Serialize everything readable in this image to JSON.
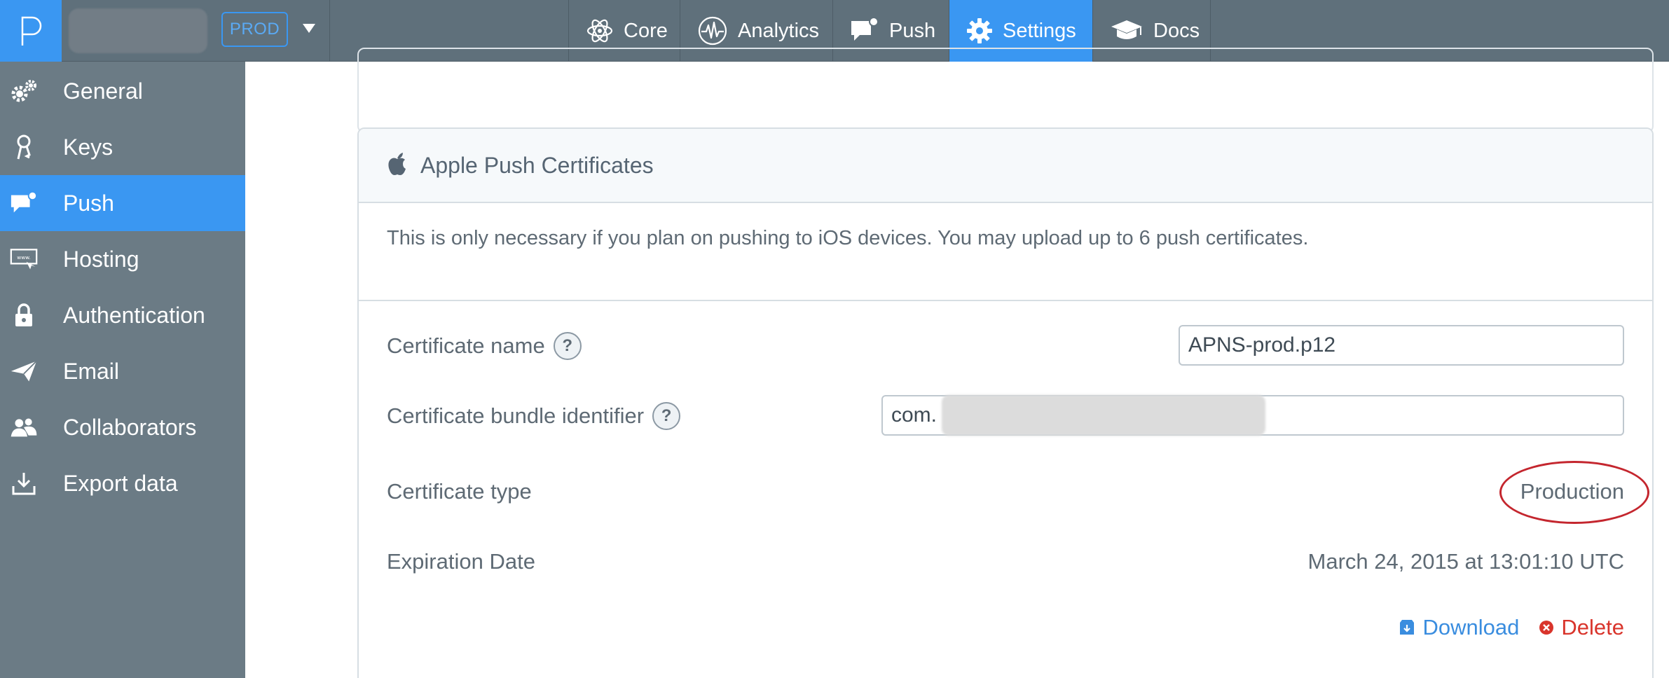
{
  "header": {
    "app_name": "",
    "env_badge": "PROD",
    "nav": [
      {
        "label": "Core",
        "icon": "atom-icon",
        "active": false
      },
      {
        "label": "Analytics",
        "icon": "pulse-icon",
        "active": false
      },
      {
        "label": "Push",
        "icon": "chat-bubble-icon",
        "active": false
      },
      {
        "label": "Settings",
        "icon": "gear-icon",
        "active": true
      },
      {
        "label": "Docs",
        "icon": "graduation-cap-icon",
        "active": false
      }
    ]
  },
  "sidebar": {
    "items": [
      {
        "label": "General",
        "icon": "gears-icon",
        "active": false
      },
      {
        "label": "Keys",
        "icon": "key-icon",
        "active": false
      },
      {
        "label": "Push",
        "icon": "chat-bubble-icon",
        "active": true
      },
      {
        "label": "Hosting",
        "icon": "hosting-icon",
        "active": false
      },
      {
        "label": "Authentication",
        "icon": "lock-icon",
        "active": false
      },
      {
        "label": "Email",
        "icon": "paper-plane-icon",
        "active": false
      },
      {
        "label": "Collaborators",
        "icon": "users-icon",
        "active": false
      },
      {
        "label": "Export data",
        "icon": "download-tray-icon",
        "active": false
      }
    ]
  },
  "certificates": {
    "title": "Apple Push Certificates",
    "description": "This is only necessary if you plan on pushing to iOS devices. You may upload up to 6 push certificates.",
    "help_glyph": "?",
    "name_label": "Certificate name",
    "name_value": "APNS-prod.p12",
    "bundle_label": "Certificate bundle identifier",
    "bundle_value": "com.",
    "type_label": "Certificate type",
    "type_value": "Production",
    "expiration_label": "Expiration Date",
    "expiration_value": "March 24, 2015 at 13:01:10 UTC",
    "download_label": "Download",
    "delete_label": "Delete"
  },
  "colors": {
    "accent": "#3a97f2",
    "topbar": "#5f707b",
    "sidebar": "#6b7b85",
    "delete": "#d9342b",
    "highlight": "#c4262e"
  }
}
